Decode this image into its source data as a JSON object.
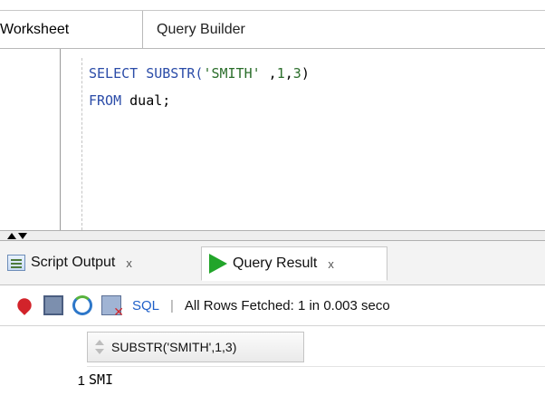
{
  "editor_tabs": [
    {
      "label": "Worksheet",
      "active": true
    },
    {
      "label": "Query Builder",
      "active": false
    }
  ],
  "editor": {
    "line1": {
      "kw1": "SELECT",
      "fn": " SUBSTR(",
      "str": "'SMITH'",
      "rest1": " ,",
      "n1": "1",
      "comma": ",",
      "n2": "3",
      "close": ")"
    },
    "line2": {
      "kw": "FROM",
      "rest": " dual;"
    }
  },
  "output_tabs": [
    {
      "label": "Script Output",
      "close": "x",
      "icon": "script-output-icon"
    },
    {
      "label": "Query Result",
      "close": "x",
      "icon": "play-icon",
      "active": true
    }
  ],
  "toolbar": {
    "icons": [
      "pin-icon",
      "print-icon",
      "refresh-icon",
      "export-icon"
    ],
    "sql_label": "SQL",
    "separator": "|",
    "status": "All Rows Fetched: 1 in 0.003 seco"
  },
  "grid": {
    "columns": [
      "SUBSTR('SMITH',1,3)"
    ],
    "rows": [
      {
        "num": "1",
        "values": [
          "SMI"
        ]
      }
    ]
  },
  "colors": {
    "keyword": "#2b4ca8",
    "string": "#2b6e2b",
    "play": "#22a52a",
    "link": "#1f5fc8"
  }
}
